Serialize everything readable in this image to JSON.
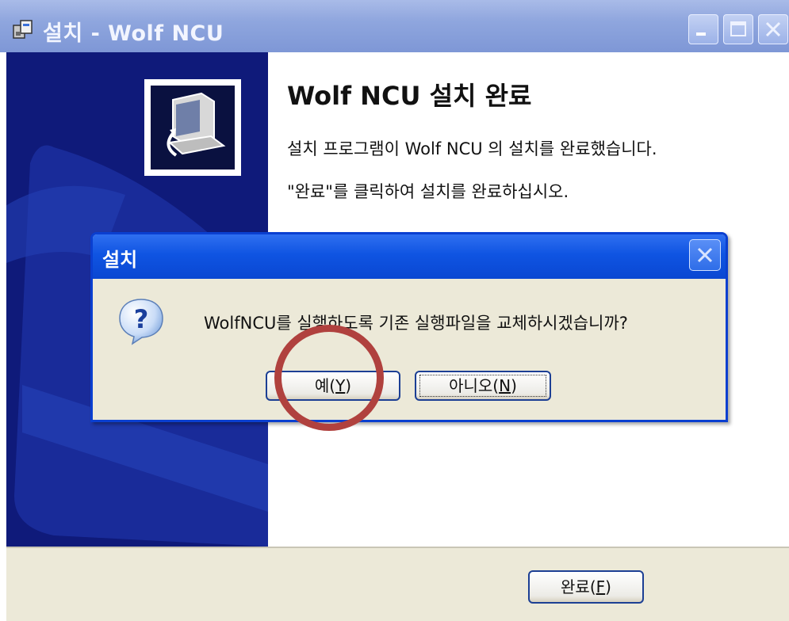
{
  "window": {
    "title": "설치 - Wolf NCU",
    "icon": "installer-icon"
  },
  "sidebar": {
    "background_color": "#0f1a7a",
    "logo": "computer-setup-icon"
  },
  "main": {
    "heading": "Wolf NCU 설치 완료",
    "line1": "설치 프로그램이 Wolf NCU 의 설치를 완료했습니다.",
    "line2": "\"완료\"를 클릭하여 설치를 완료하십시오."
  },
  "footer": {
    "finish_pre": "완료(",
    "finish_key": "F",
    "finish_post": ")"
  },
  "dialog": {
    "title": "설치",
    "icon": "question-icon",
    "message": "WolfNCU를 실행하도록 기존 실행파일을 교체하시겠습니까?",
    "yes_pre": "예(",
    "yes_key": "Y",
    "yes_post": ")",
    "no_pre": "아니오(",
    "no_key": "N",
    "no_post": ")"
  },
  "colors": {
    "titlebar_inactive": "#8fa6de",
    "dialog_titlebar": "#0f54e2",
    "annotation_circle": "#b0413e"
  }
}
